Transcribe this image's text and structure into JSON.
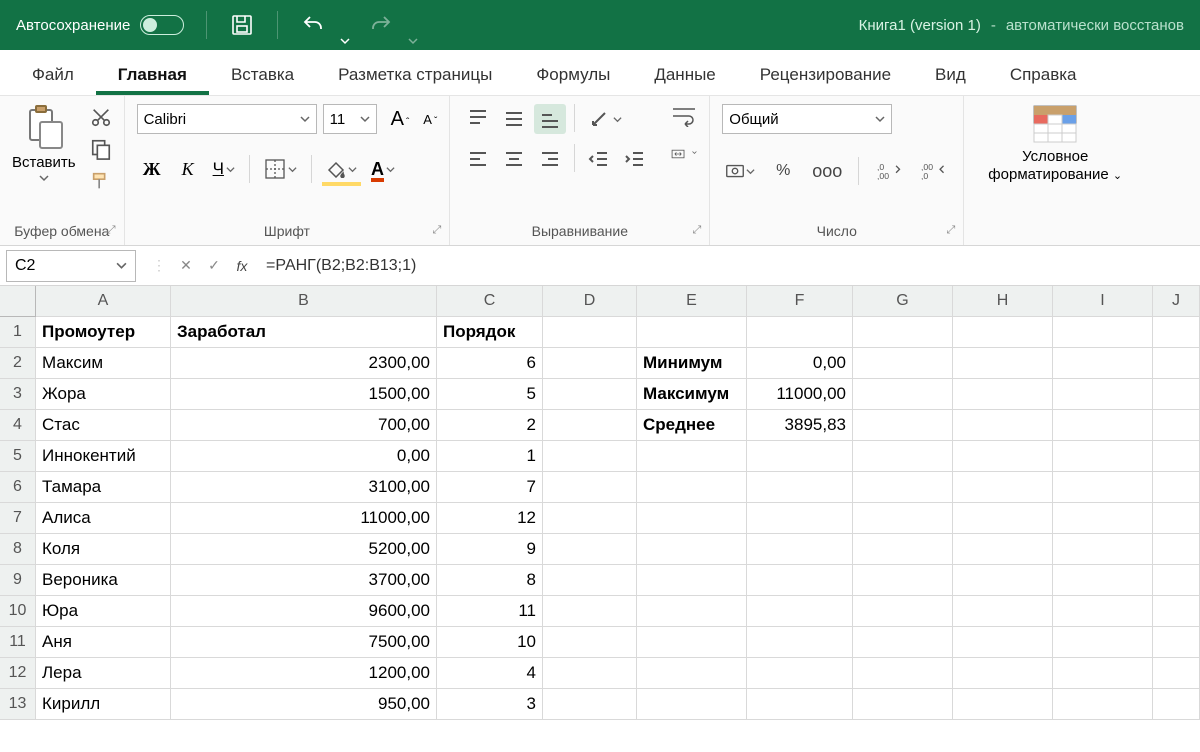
{
  "titlebar": {
    "autosave_label": "Автосохранение",
    "book_name": "Книга1 (version 1)",
    "book_sep": " - ",
    "book_suffix": "автоматически восстанов"
  },
  "tabs": {
    "file": "Файл",
    "home": "Главная",
    "insert": "Вставка",
    "layout": "Разметка страницы",
    "formulas": "Формулы",
    "data": "Данные",
    "review": "Рецензирование",
    "view": "Вид",
    "help": "Справка"
  },
  "ribbon": {
    "clipboard": {
      "paste": "Вставить",
      "label": "Буфер обмена"
    },
    "font": {
      "name": "Calibri",
      "size": "11",
      "bold": "Ж",
      "italic": "К",
      "underline": "Ч",
      "label": "Шрифт",
      "fontcolor_letter": "А"
    },
    "align": {
      "label": "Выравнивание"
    },
    "number": {
      "format": "Общий",
      "label": "Число"
    },
    "cond": {
      "line1": "Условное",
      "line2": "форматирование"
    }
  },
  "formula_bar": {
    "cell_ref": "C2",
    "fx_label": "fx",
    "formula": "=РАНГ(B2;B2:B13;1)"
  },
  "grid": {
    "col_headers": [
      "A",
      "B",
      "C",
      "D",
      "E",
      "F",
      "G",
      "H",
      "I",
      "J"
    ],
    "row_headers": [
      "1",
      "2",
      "3",
      "4",
      "5",
      "6",
      "7",
      "8",
      "9",
      "10",
      "11",
      "12",
      "13"
    ],
    "headers_row": {
      "A": "Промоутер",
      "B": "Заработал",
      "C": "Порядок"
    },
    "rows": [
      {
        "A": "Максим",
        "B": "2300,00",
        "C": "6",
        "E": "Минимум",
        "F": "0,00"
      },
      {
        "A": "Жора",
        "B": "1500,00",
        "C": "5",
        "E": "Максимум",
        "F": "11000,00"
      },
      {
        "A": "Стас",
        "B": "700,00",
        "C": "2",
        "E": "Среднее",
        "F": "3895,83"
      },
      {
        "A": "Иннокентий",
        "B": "0,00",
        "C": "1"
      },
      {
        "A": "Тамара",
        "B": "3100,00",
        "C": "7"
      },
      {
        "A": "Алиса",
        "B": "11000,00",
        "C": "12"
      },
      {
        "A": "Коля",
        "B": "5200,00",
        "C": "9"
      },
      {
        "A": "Вероника",
        "B": "3700,00",
        "C": "8"
      },
      {
        "A": "Юра",
        "B": "9600,00",
        "C": "11"
      },
      {
        "A": "Аня",
        "B": "7500,00",
        "C": "10"
      },
      {
        "A": "Лера",
        "B": "1200,00",
        "C": "4"
      },
      {
        "A": "Кирилл",
        "B": "950,00",
        "C": "3"
      }
    ]
  }
}
